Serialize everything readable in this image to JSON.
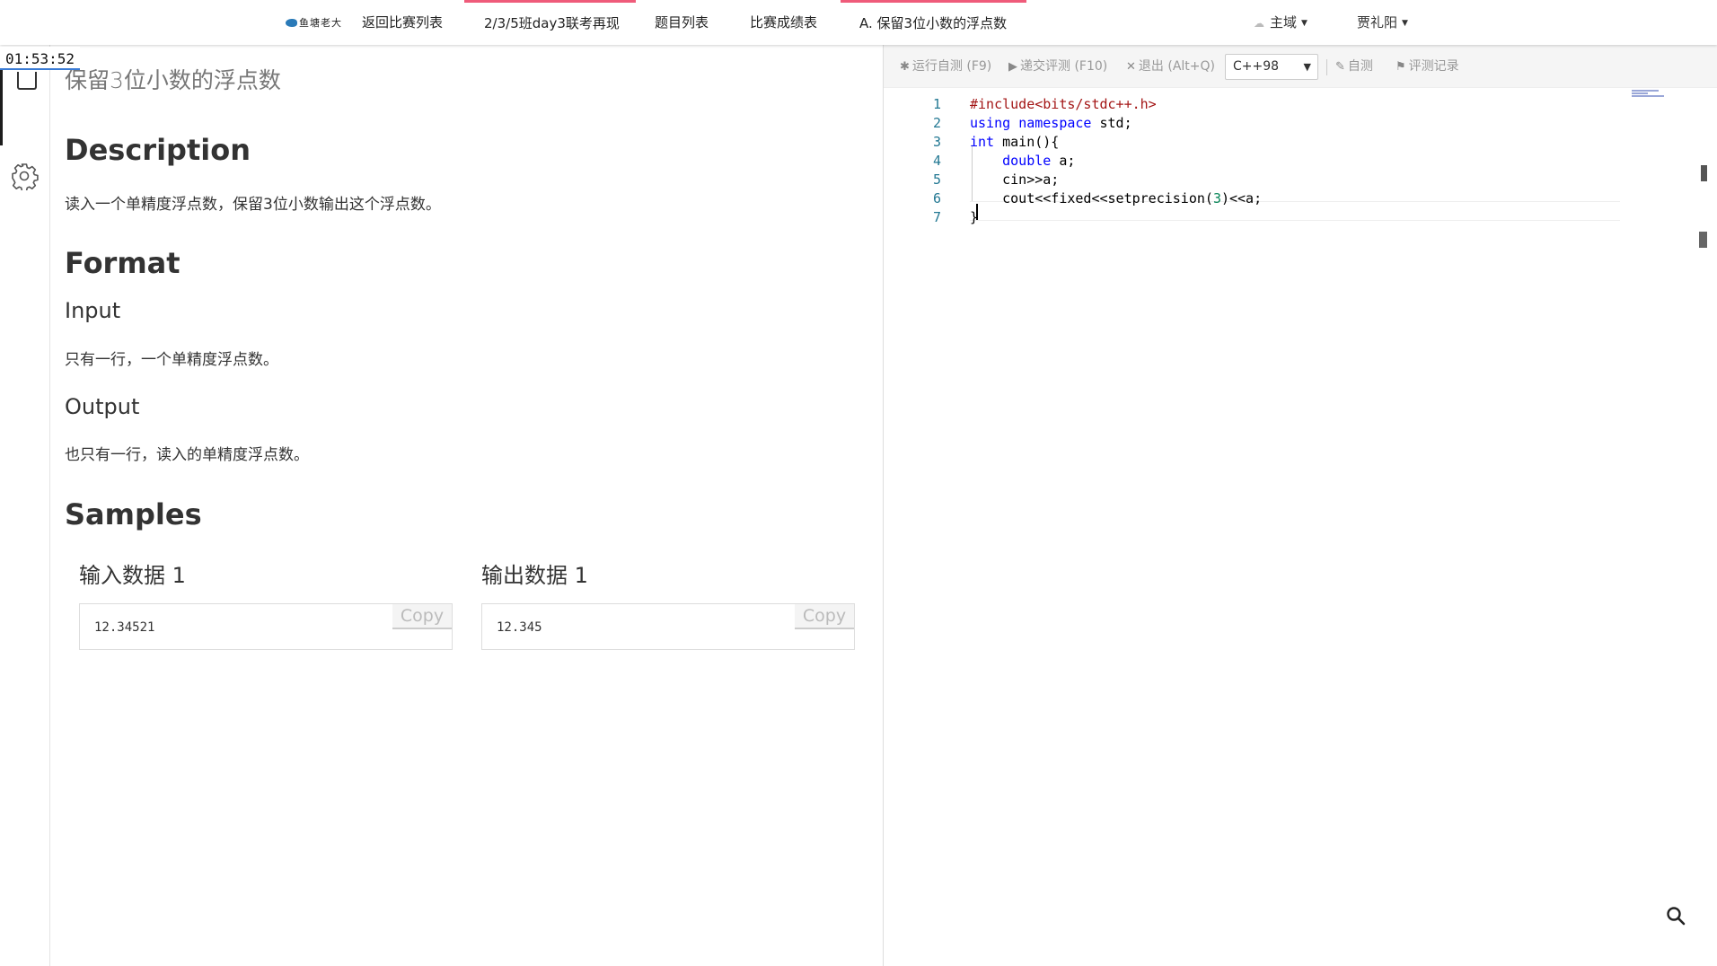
{
  "nav": {
    "logo_text": "鱼塘老大",
    "items": [
      {
        "label": "返回比赛列表"
      },
      {
        "label": "2/3/5班day3联考再现"
      },
      {
        "label": "题目列表"
      },
      {
        "label": "比赛成绩表"
      },
      {
        "label": "A. 保留3位小数的浮点数"
      }
    ],
    "domain_label": "主域",
    "user_name": "贾礼阳"
  },
  "timer": "01:53:52",
  "problem": {
    "title": "保留3位小数的浮点数",
    "description_heading": "Description",
    "description_text": "读入一个单精度浮点数，保留3位小数输出这个浮点数。",
    "format_heading": "Format",
    "input_heading": "Input",
    "input_text": "只有一行，一个单精度浮点数。",
    "output_heading": "Output",
    "output_text": "也只有一行，读入的单精度浮点数。",
    "samples_heading": "Samples",
    "samples": [
      {
        "title": "输入数据 1",
        "value": "12.34521",
        "copy_label": "Copy"
      },
      {
        "title": "输出数据 1",
        "value": "12.345",
        "copy_label": "Copy"
      }
    ]
  },
  "editor": {
    "toolbar": {
      "run_label": "运行自测 (F9)",
      "submit_label": "递交评测 (F10)",
      "exit_label": "退出 (Alt+Q)",
      "language": "C++98",
      "selftest_label": "自测",
      "records_label": "评测记录"
    },
    "line_numbers": [
      "1",
      "2",
      "3",
      "4",
      "5",
      "6",
      "7"
    ],
    "code": [
      [
        {
          "t": "#include<bits/stdc++.h>",
          "c": "str"
        }
      ],
      [
        {
          "t": "using",
          "c": "kw"
        },
        {
          "t": " "
        },
        {
          "t": "namespace",
          "c": "kw"
        },
        {
          "t": " std;"
        }
      ],
      [
        {
          "t": "int",
          "c": "kw"
        },
        {
          "t": " main(){"
        }
      ],
      [
        {
          "t": "    "
        },
        {
          "t": "double",
          "c": "kw"
        },
        {
          "t": " a;"
        }
      ],
      [
        {
          "t": "    cin>>a;"
        }
      ],
      [
        {
          "t": "    cout<<fixed<<setprecision("
        },
        {
          "t": "3",
          "c": "num"
        },
        {
          "t": ")<<a;"
        }
      ],
      [
        {
          "t": "}"
        }
      ]
    ]
  }
}
